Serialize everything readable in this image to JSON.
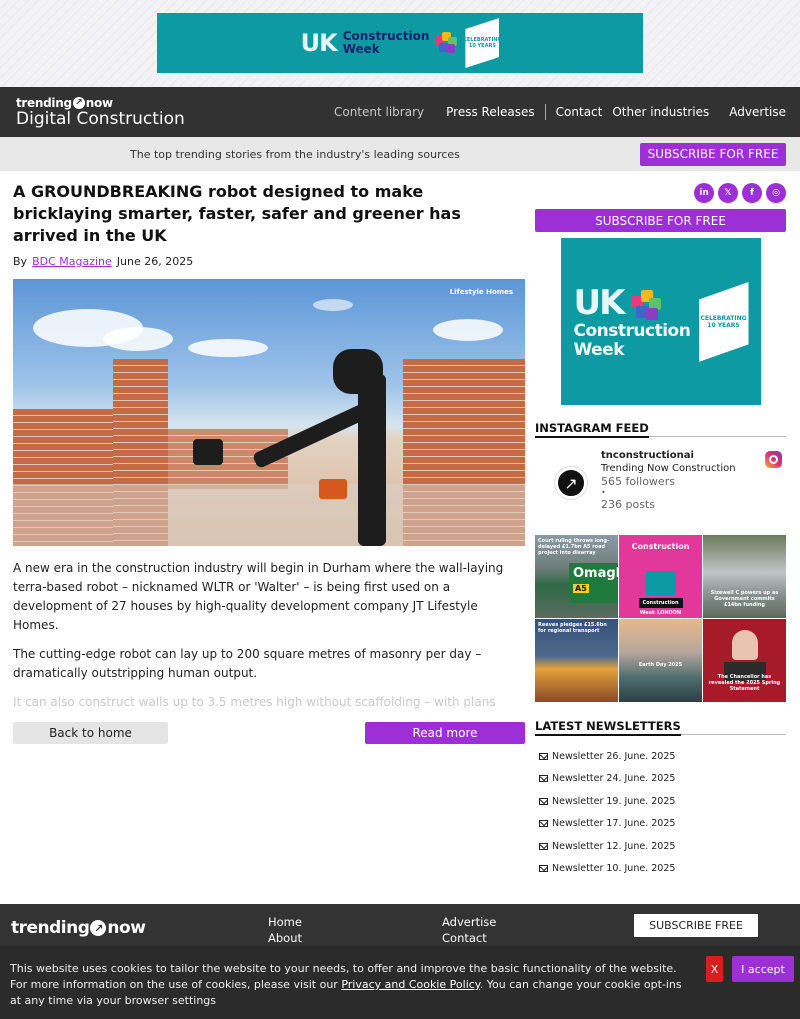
{
  "top_ad": {
    "uk": "UK",
    "line1": "Construction",
    "line2": "Week",
    "badge": "CELEBRATING 10 YEARS"
  },
  "header": {
    "brand_small": "trending",
    "brand_small_suffix": "now",
    "brand_big": "Digital Construction",
    "nav": {
      "content_library": "Content library",
      "press_releases": "Press Releases",
      "contact": "Contact",
      "other_industries": "Other industries",
      "advertise": "Advertise"
    }
  },
  "subbar": {
    "text": "The top trending stories from the industry's leading sources",
    "subscribe": "SUBSCRIBE FOR FREE"
  },
  "article": {
    "headline": "A GROUNDBREAKING robot designed to make bricklaying smarter, faster, safer and greener has arrived in the UK",
    "by": "By",
    "author": "BDC Magazine",
    "date": "June 26, 2025",
    "image_watermark": "Lifestyle Homes",
    "paragraphs": [
      "A new era in the construction industry will begin in Durham where the wall-laying terra-based robot – nicknamed WLTR or 'Walter' – is being first used on a development of 27 houses by high-quality development company JT Lifestyle Homes.",
      "The cutting-edge robot can lay up to 200 square metres of masonry per day – dramatically outstripping human output.",
      "It can also construct walls up to 3.5 metres high without scaffolding – with plans"
    ],
    "back_button": "Back to home",
    "read_more_button": "Read more"
  },
  "sidebar": {
    "socials": [
      "in",
      "𝕏",
      "f",
      "◎"
    ],
    "subscribe": "SUBSCRIBE FOR FREE",
    "ad": {
      "uk": "UK",
      "line1": "Construction",
      "line2": "Week",
      "badge": "CELEBRATING 10 YEARS"
    },
    "instagram": {
      "title": "INSTAGRAM FEED",
      "username": "tnconstructionai",
      "name": "Trending Now Construction",
      "followers": "565 followers",
      "dot": "•",
      "posts": "236 posts",
      "tiles": [
        {
          "caption": "Court ruling throws long-delayed £1.7bn A5 road project into disarray",
          "sign": "Omagh",
          "road": "A5"
        },
        {
          "caption": "Construction",
          "sub": "Construction Week LONDON"
        },
        {
          "caption": "Sizewell C powers up as Government commits £14bn funding"
        },
        {
          "caption": "Reeves pledges £15.6bn for regional transport"
        },
        {
          "caption": "Earth Day 2025"
        },
        {
          "caption": "The Chancellor has revealed the 2025 Spring Statement"
        }
      ]
    },
    "newsletters": {
      "title": "LATEST NEWSLETTERS",
      "items": [
        "Newsletter 26. June. 2025",
        "Newsletter 24. June. 2025",
        "Newsletter 19. June. 2025",
        "Newsletter 17. June. 2025",
        "Newsletter 12. June. 2025",
        "Newsletter 10. June. 2025"
      ]
    }
  },
  "footer": {
    "logo": "trending",
    "logo_suffix": "now",
    "col1": [
      "Home",
      "About"
    ],
    "col2": [
      "Advertise",
      "Contact"
    ],
    "subscribe": "SUBSCRIBE FREE"
  },
  "cookie": {
    "text_before": "This website uses cookies to tailor the website to your needs, to offer and improve the basic functionality of the website. For more information on the use of cookies, please visit our ",
    "link": "Privacy and Cookie Policy",
    "text_after": ". You can change your cookie opt-ins at any time via your browser settings",
    "reject": "X",
    "accept": "I accept"
  },
  "colors": {
    "accent": "#9d2fd6",
    "header_bg": "#323232",
    "ad_teal": "#0d9aa3",
    "reject": "#d71f1f"
  }
}
